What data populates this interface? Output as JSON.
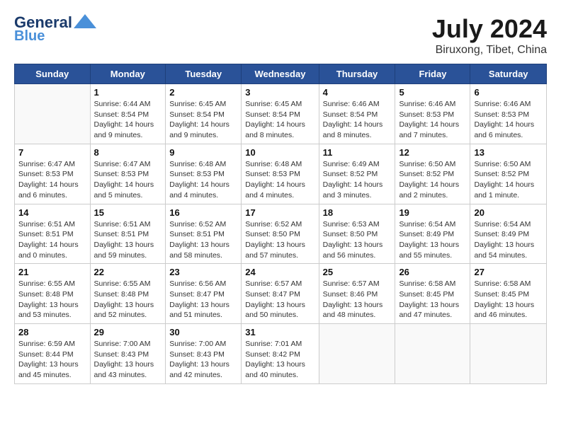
{
  "header": {
    "logo_line1": "General",
    "logo_line2": "Blue",
    "title": "July 2024",
    "location": "Biruxong, Tibet, China"
  },
  "days_of_week": [
    "Sunday",
    "Monday",
    "Tuesday",
    "Wednesday",
    "Thursday",
    "Friday",
    "Saturday"
  ],
  "weeks": [
    [
      {
        "day": "",
        "sunrise": "",
        "sunset": "",
        "daylight": ""
      },
      {
        "day": "1",
        "sunrise": "Sunrise: 6:44 AM",
        "sunset": "Sunset: 8:54 PM",
        "daylight": "Daylight: 14 hours and 9 minutes."
      },
      {
        "day": "2",
        "sunrise": "Sunrise: 6:45 AM",
        "sunset": "Sunset: 8:54 PM",
        "daylight": "Daylight: 14 hours and 9 minutes."
      },
      {
        "day": "3",
        "sunrise": "Sunrise: 6:45 AM",
        "sunset": "Sunset: 8:54 PM",
        "daylight": "Daylight: 14 hours and 8 minutes."
      },
      {
        "day": "4",
        "sunrise": "Sunrise: 6:46 AM",
        "sunset": "Sunset: 8:54 PM",
        "daylight": "Daylight: 14 hours and 8 minutes."
      },
      {
        "day": "5",
        "sunrise": "Sunrise: 6:46 AM",
        "sunset": "Sunset: 8:53 PM",
        "daylight": "Daylight: 14 hours and 7 minutes."
      },
      {
        "day": "6",
        "sunrise": "Sunrise: 6:46 AM",
        "sunset": "Sunset: 8:53 PM",
        "daylight": "Daylight: 14 hours and 6 minutes."
      }
    ],
    [
      {
        "day": "7",
        "sunrise": "Sunrise: 6:47 AM",
        "sunset": "Sunset: 8:53 PM",
        "daylight": "Daylight: 14 hours and 6 minutes."
      },
      {
        "day": "8",
        "sunrise": "Sunrise: 6:47 AM",
        "sunset": "Sunset: 8:53 PM",
        "daylight": "Daylight: 14 hours and 5 minutes."
      },
      {
        "day": "9",
        "sunrise": "Sunrise: 6:48 AM",
        "sunset": "Sunset: 8:53 PM",
        "daylight": "Daylight: 14 hours and 4 minutes."
      },
      {
        "day": "10",
        "sunrise": "Sunrise: 6:48 AM",
        "sunset": "Sunset: 8:53 PM",
        "daylight": "Daylight: 14 hours and 4 minutes."
      },
      {
        "day": "11",
        "sunrise": "Sunrise: 6:49 AM",
        "sunset": "Sunset: 8:52 PM",
        "daylight": "Daylight: 14 hours and 3 minutes."
      },
      {
        "day": "12",
        "sunrise": "Sunrise: 6:50 AM",
        "sunset": "Sunset: 8:52 PM",
        "daylight": "Daylight: 14 hours and 2 minutes."
      },
      {
        "day": "13",
        "sunrise": "Sunrise: 6:50 AM",
        "sunset": "Sunset: 8:52 PM",
        "daylight": "Daylight: 14 hours and 1 minute."
      }
    ],
    [
      {
        "day": "14",
        "sunrise": "Sunrise: 6:51 AM",
        "sunset": "Sunset: 8:51 PM",
        "daylight": "Daylight: 14 hours and 0 minutes."
      },
      {
        "day": "15",
        "sunrise": "Sunrise: 6:51 AM",
        "sunset": "Sunset: 8:51 PM",
        "daylight": "Daylight: 13 hours and 59 minutes."
      },
      {
        "day": "16",
        "sunrise": "Sunrise: 6:52 AM",
        "sunset": "Sunset: 8:51 PM",
        "daylight": "Daylight: 13 hours and 58 minutes."
      },
      {
        "day": "17",
        "sunrise": "Sunrise: 6:52 AM",
        "sunset": "Sunset: 8:50 PM",
        "daylight": "Daylight: 13 hours and 57 minutes."
      },
      {
        "day": "18",
        "sunrise": "Sunrise: 6:53 AM",
        "sunset": "Sunset: 8:50 PM",
        "daylight": "Daylight: 13 hours and 56 minutes."
      },
      {
        "day": "19",
        "sunrise": "Sunrise: 6:54 AM",
        "sunset": "Sunset: 8:49 PM",
        "daylight": "Daylight: 13 hours and 55 minutes."
      },
      {
        "day": "20",
        "sunrise": "Sunrise: 6:54 AM",
        "sunset": "Sunset: 8:49 PM",
        "daylight": "Daylight: 13 hours and 54 minutes."
      }
    ],
    [
      {
        "day": "21",
        "sunrise": "Sunrise: 6:55 AM",
        "sunset": "Sunset: 8:48 PM",
        "daylight": "Daylight: 13 hours and 53 minutes."
      },
      {
        "day": "22",
        "sunrise": "Sunrise: 6:55 AM",
        "sunset": "Sunset: 8:48 PM",
        "daylight": "Daylight: 13 hours and 52 minutes."
      },
      {
        "day": "23",
        "sunrise": "Sunrise: 6:56 AM",
        "sunset": "Sunset: 8:47 PM",
        "daylight": "Daylight: 13 hours and 51 minutes."
      },
      {
        "day": "24",
        "sunrise": "Sunrise: 6:57 AM",
        "sunset": "Sunset: 8:47 PM",
        "daylight": "Daylight: 13 hours and 50 minutes."
      },
      {
        "day": "25",
        "sunrise": "Sunrise: 6:57 AM",
        "sunset": "Sunset: 8:46 PM",
        "daylight": "Daylight: 13 hours and 48 minutes."
      },
      {
        "day": "26",
        "sunrise": "Sunrise: 6:58 AM",
        "sunset": "Sunset: 8:45 PM",
        "daylight": "Daylight: 13 hours and 47 minutes."
      },
      {
        "day": "27",
        "sunrise": "Sunrise: 6:58 AM",
        "sunset": "Sunset: 8:45 PM",
        "daylight": "Daylight: 13 hours and 46 minutes."
      }
    ],
    [
      {
        "day": "28",
        "sunrise": "Sunrise: 6:59 AM",
        "sunset": "Sunset: 8:44 PM",
        "daylight": "Daylight: 13 hours and 45 minutes."
      },
      {
        "day": "29",
        "sunrise": "Sunrise: 7:00 AM",
        "sunset": "Sunset: 8:43 PM",
        "daylight": "Daylight: 13 hours and 43 minutes."
      },
      {
        "day": "30",
        "sunrise": "Sunrise: 7:00 AM",
        "sunset": "Sunset: 8:43 PM",
        "daylight": "Daylight: 13 hours and 42 minutes."
      },
      {
        "day": "31",
        "sunrise": "Sunrise: 7:01 AM",
        "sunset": "Sunset: 8:42 PM",
        "daylight": "Daylight: 13 hours and 40 minutes."
      },
      {
        "day": "",
        "sunrise": "",
        "sunset": "",
        "daylight": ""
      },
      {
        "day": "",
        "sunrise": "",
        "sunset": "",
        "daylight": ""
      },
      {
        "day": "",
        "sunrise": "",
        "sunset": "",
        "daylight": ""
      }
    ]
  ]
}
